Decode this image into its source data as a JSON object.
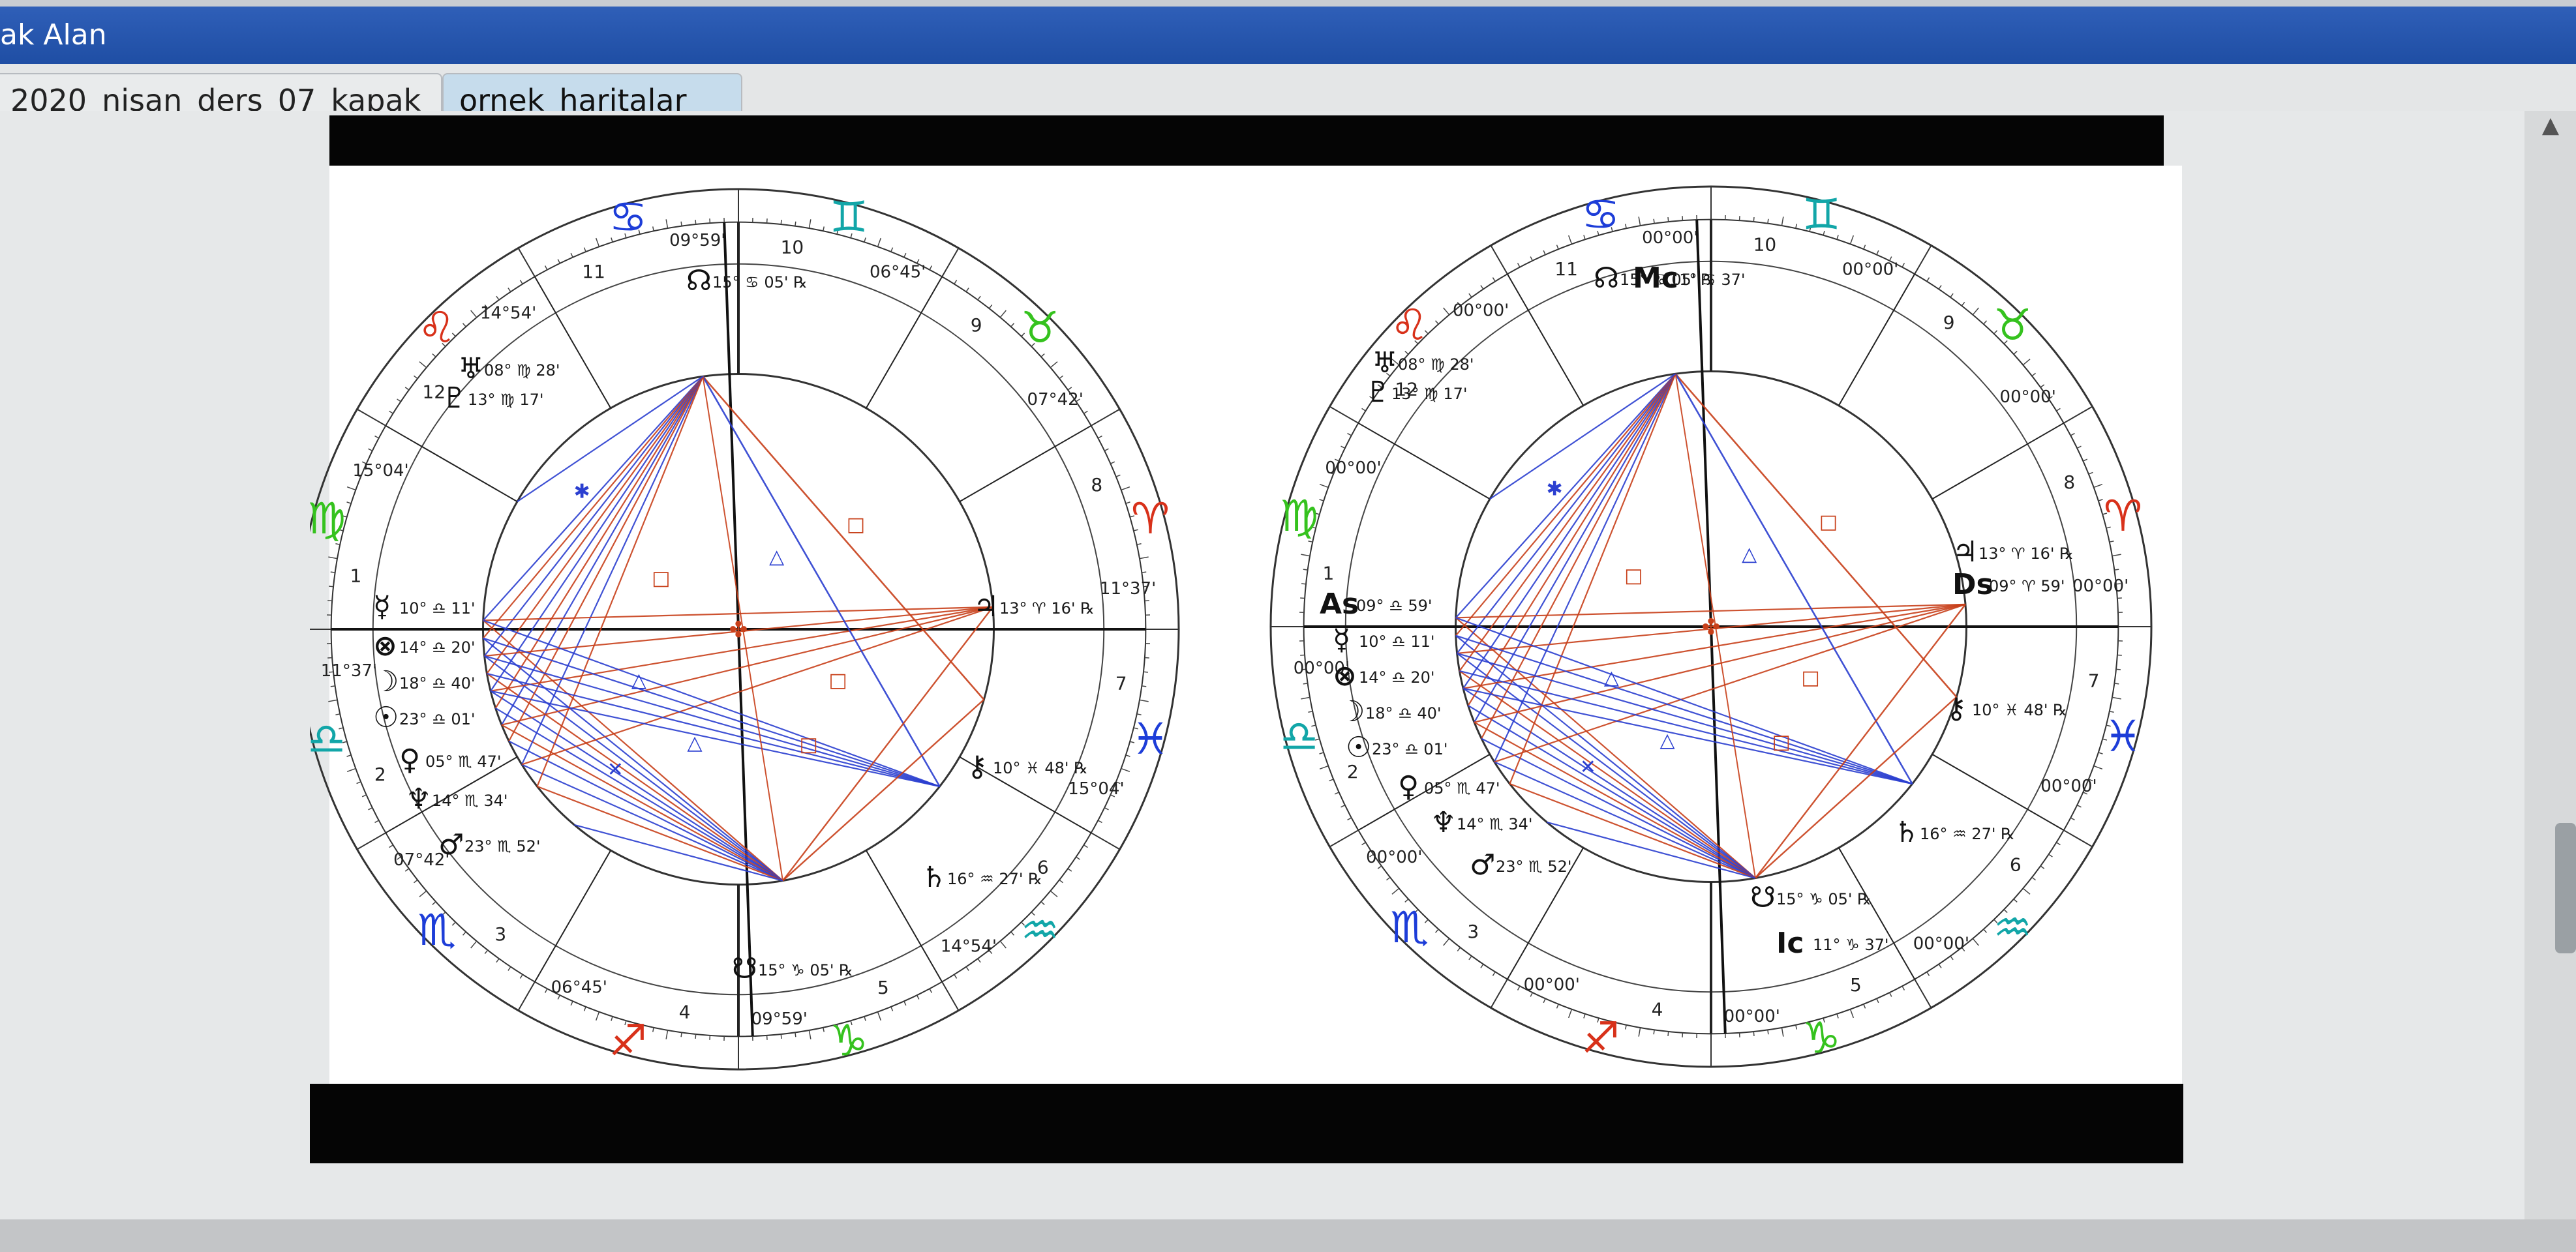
{
  "window": {
    "title": "ak Alan"
  },
  "tabs": [
    {
      "label": "2020_nisan_ders_07_kapak",
      "active": false
    },
    {
      "label": "ornek_haritalar",
      "active": true
    }
  ],
  "colors": {
    "red_aspect": "#c8401a",
    "blue_aspect": "#2b3fd0",
    "fire": "#d8311a",
    "earth": "#35c21e",
    "air": "#12a6a8",
    "water": "#1d3dd8",
    "titlebar": "#2556b0"
  },
  "chart1": {
    "house_numbers": [
      "1",
      "2",
      "3",
      "4",
      "5",
      "6",
      "7",
      "8",
      "9",
      "10",
      "11",
      "12"
    ],
    "cusp_labels": [
      "11°37'",
      "07°42'",
      "06°45'",
      "09°59'",
      "14°54'",
      "15°04'",
      "11°37'",
      "07°42'",
      "06°45'",
      "09°59'",
      "14°54'",
      "15°04'"
    ],
    "planets": [
      {
        "glyph": "☊",
        "text": "15° ♋ 05' ℞"
      },
      {
        "glyph": "♅",
        "text": "08° ♍ 28'"
      },
      {
        "glyph": "♇",
        "text": "13° ♍ 17'"
      },
      {
        "glyph": "☿",
        "text": "10° ♎ 11'"
      },
      {
        "glyph": "⊗",
        "text": "14° ♎ 20'"
      },
      {
        "glyph": "☽",
        "text": "18° ♎ 40'"
      },
      {
        "glyph": "☉",
        "text": "23° ♎ 01'"
      },
      {
        "glyph": "♀",
        "text": "05° ♏ 47'"
      },
      {
        "glyph": "♆",
        "text": "14° ♏ 34'"
      },
      {
        "glyph": "♂",
        "text": "23° ♏ 52'"
      },
      {
        "glyph": "♄",
        "text": "16° ♒ 27' ℞"
      },
      {
        "glyph": "⚷",
        "text": "10° ♓ 48' ℞"
      },
      {
        "glyph": "♃",
        "text": "13° ♈ 16' ℞"
      },
      {
        "glyph": "☋",
        "text": "15° ♑ 05' ℞"
      }
    ]
  },
  "chart2": {
    "house_numbers": [
      "1",
      "2",
      "3",
      "4",
      "5",
      "6",
      "7",
      "8",
      "9",
      "10",
      "11",
      "12"
    ],
    "cusp_labels": [
      "00°00'",
      "00°00'",
      "00°00'",
      "00°00'",
      "00°00'",
      "00°00'",
      "00°00'",
      "00°00'",
      "00°00'",
      "00°00'",
      "00°00'",
      "00°00'"
    ],
    "angles": {
      "asc": "As",
      "mc": "Mc",
      "dsc": "Ds",
      "ic": "Ic"
    },
    "planets": [
      {
        "glyph": "☊",
        "text": "15° ♋ 05' ℞"
      },
      {
        "glyph": "Mc",
        "text": "11° ♋ 37'"
      },
      {
        "glyph": "♅",
        "text": "08° ♍ 28'"
      },
      {
        "glyph": "♇",
        "text": "13° ♍ 17'"
      },
      {
        "glyph": "As",
        "text": "09° ♎ 59'"
      },
      {
        "glyph": "☿",
        "text": "10° ♎ 11'"
      },
      {
        "glyph": "⊗",
        "text": "14° ♎ 20'"
      },
      {
        "glyph": "☽",
        "text": "18° ♎ 40'"
      },
      {
        "glyph": "☉",
        "text": "23° ♎ 01'"
      },
      {
        "glyph": "♀",
        "text": "05° ♏ 47'"
      },
      {
        "glyph": "♆",
        "text": "14° ♏ 34'"
      },
      {
        "glyph": "♂",
        "text": "23° ♏ 52'"
      },
      {
        "glyph": "♄",
        "text": "16° ♒ 27' ℞"
      },
      {
        "glyph": "⚷",
        "text": "10° ♓ 48' ℞"
      },
      {
        "glyph": "♃",
        "text": "13° ♈ 16' ℞"
      },
      {
        "glyph": "Ds",
        "text": "09° ♈ 59'"
      },
      {
        "glyph": "☋",
        "text": "15° ♑ 05' ℞"
      },
      {
        "glyph": "Ic",
        "text": "11° ♑ 37'"
      }
    ]
  }
}
